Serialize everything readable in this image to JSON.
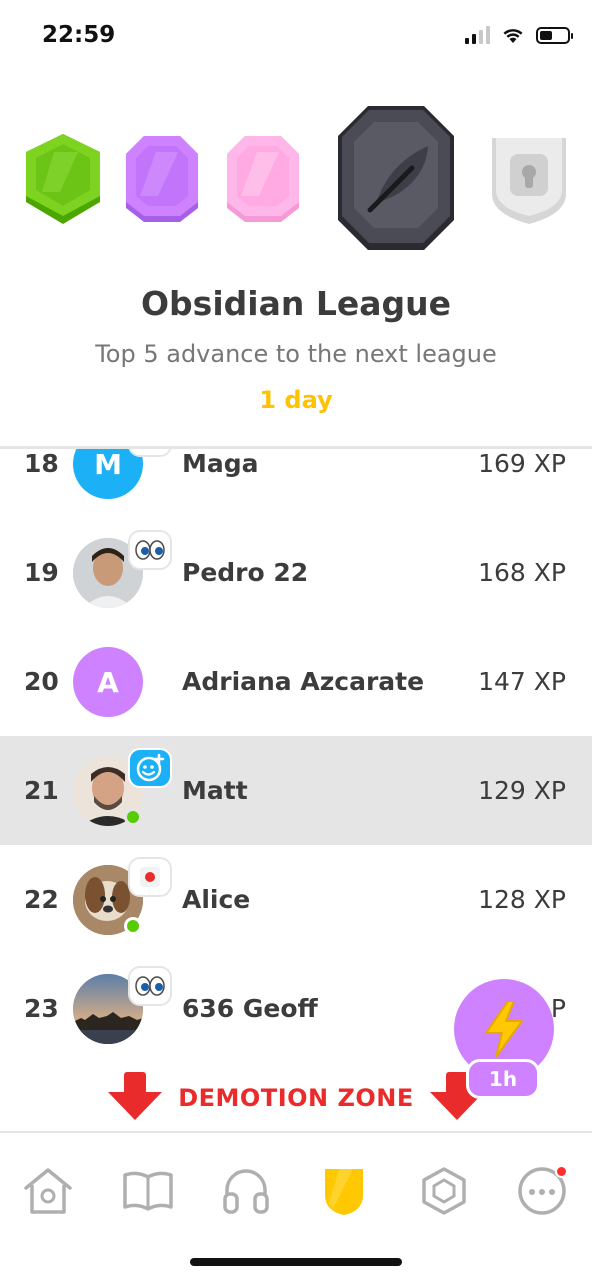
{
  "status_bar": {
    "time": "22:59"
  },
  "league": {
    "title": "Obsidian League",
    "subtitle": "Top 5 advance to the next league",
    "time_left": "1 day",
    "badges": [
      {
        "name": "emerald",
        "color": "#58cc02",
        "state": "past"
      },
      {
        "name": "amethyst",
        "color": "#ce82ff",
        "state": "past"
      },
      {
        "name": "pearl",
        "color": "#ffa7e4",
        "state": "past"
      },
      {
        "name": "obsidian",
        "color": "#4b4b55",
        "state": "current"
      },
      {
        "name": "diamond",
        "color": "#e5e5e5",
        "state": "locked"
      }
    ]
  },
  "leaderboard": [
    {
      "rank": "18",
      "name": "Maga",
      "xp": "169 XP",
      "avatar_letter": "M",
      "avatar_color": "#1cb0f6",
      "reaction": "none",
      "online": false,
      "current_user": false
    },
    {
      "rank": "19",
      "name": "Pedro 22",
      "xp": "168 XP",
      "avatar_letter": "",
      "avatar_color": "#d8d8d8",
      "reaction": "eyes-icon",
      "online": false,
      "current_user": false
    },
    {
      "rank": "20",
      "name": "Adriana Azcarate",
      "xp": "147 XP",
      "avatar_letter": "A",
      "avatar_color": "#ce82ff",
      "reaction": "none",
      "online": false,
      "current_user": false
    },
    {
      "rank": "21",
      "name": "Matt",
      "xp": "129 XP",
      "avatar_letter": "",
      "avatar_color": "#f0e6dc",
      "reaction": "add-reaction-icon",
      "online": true,
      "current_user": true
    },
    {
      "rank": "22",
      "name": "Alice",
      "xp": "128 XP",
      "avatar_letter": "",
      "avatar_color": "#9a7a5a",
      "reaction": "record-icon",
      "online": true,
      "current_user": false
    },
    {
      "rank": "23",
      "name": "636 Geoff",
      "xp": "…P",
      "avatar_letter": "",
      "avatar_color": "#8a9bb0",
      "reaction": "eyes-icon",
      "online": false,
      "current_user": false
    }
  ],
  "demotion": {
    "label": "DEMOTION ZONE",
    "color": "#ea2b2b"
  },
  "boost": {
    "timer": "1h",
    "icon": "lightning-icon"
  },
  "tabs": [
    {
      "id": "home",
      "icon": "home-icon",
      "active": false
    },
    {
      "id": "stories",
      "icon": "book-icon",
      "active": false
    },
    {
      "id": "podcasts",
      "icon": "headphones-icon",
      "active": false
    },
    {
      "id": "leagues",
      "icon": "shield-icon",
      "active": true
    },
    {
      "id": "gems",
      "icon": "gem-icon",
      "active": false
    },
    {
      "id": "more",
      "icon": "more-icon",
      "active": false,
      "notification": true
    }
  ]
}
